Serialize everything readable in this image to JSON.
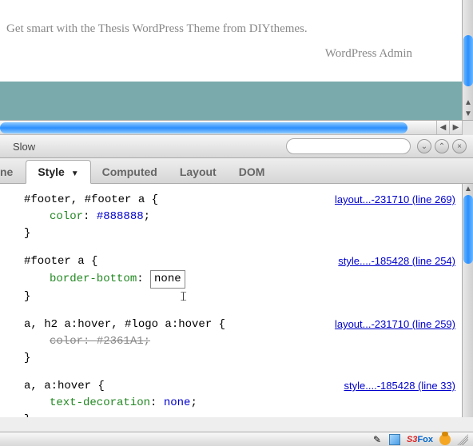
{
  "page": {
    "footer_text": "Get smart with the Thesis WordPress Theme from DIYthemes.",
    "admin_link": "WordPress Admin"
  },
  "firebug": {
    "toolbar": {
      "left_tab": "Slow",
      "search_placeholder": ""
    },
    "tabs": {
      "left_cut": "ne",
      "style": "Style",
      "computed": "Computed",
      "layout": "Layout",
      "dom": "DOM"
    },
    "rules": [
      {
        "selector": "#footer, #footer a {",
        "props": [
          {
            "name": "color",
            "value": "#888888",
            "end": ";"
          }
        ],
        "close": "}",
        "source": "layout...-231710 (line 269)"
      },
      {
        "selector": "#footer a {",
        "props": [
          {
            "name": "border-bottom",
            "value": "none",
            "editing": true
          }
        ],
        "close": "}",
        "source": "style....-185428 (line 254)"
      },
      {
        "selector": "a, h2 a:hover, #logo a:hover {",
        "props": [
          {
            "name": "color",
            "value": "#2361A1",
            "end": ";",
            "strike": true
          }
        ],
        "close": "}",
        "source": "layout...-231710 (line 259)"
      },
      {
        "selector": "a, a:hover {",
        "props": [
          {
            "name": "text-decoration",
            "value": "none",
            "end": ";"
          }
        ],
        "close": "}",
        "source": "style....-185428 (line 33)"
      }
    ]
  },
  "status": {
    "s3fox": "S3Fox"
  }
}
